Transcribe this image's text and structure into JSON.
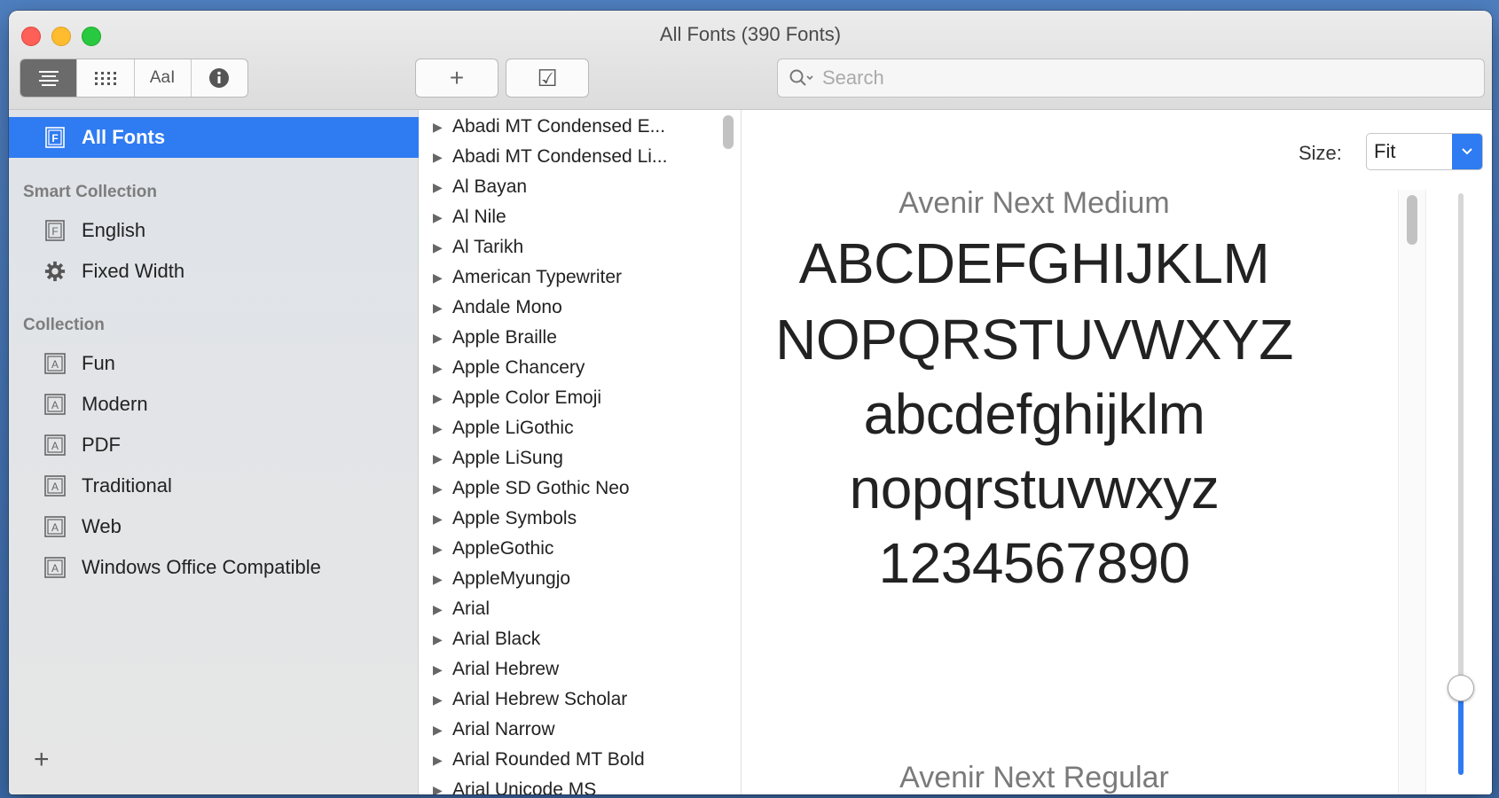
{
  "window": {
    "title": "All Fonts (390 Fonts)"
  },
  "toolbar": {
    "view_text_label": "AaI",
    "add_symbol": "+",
    "validate_symbol": "☑",
    "search_placeholder": "Search"
  },
  "sidebar": {
    "all_fonts": "All Fonts",
    "smart_heading": "Smart Collection",
    "smart_items": [
      "English",
      "Fixed Width"
    ],
    "collection_heading": "Collection",
    "collection_items": [
      "Fun",
      "Modern",
      "PDF",
      "Traditional",
      "Web",
      "Windows Office Compatible"
    ],
    "add_symbol": "+"
  },
  "font_list": [
    "Abadi MT Condensed E...",
    "Abadi MT Condensed Li...",
    "Al Bayan",
    "Al Nile",
    "Al Tarikh",
    "American Typewriter",
    "Andale Mono",
    "Apple Braille",
    "Apple Chancery",
    "Apple Color Emoji",
    "Apple LiGothic",
    "Apple LiSung",
    "Apple SD Gothic Neo",
    "Apple Symbols",
    "AppleGothic",
    "AppleMyungjo",
    "Arial",
    "Arial Black",
    "Arial Hebrew",
    "Arial Hebrew Scholar",
    "Arial Narrow",
    "Arial Rounded MT Bold",
    "Arial Unicode MS"
  ],
  "preview": {
    "size_label": "Size:",
    "size_value": "Fit",
    "font_name_1": "Avenir Next Medium",
    "lines": [
      "ABCDEFGHIJKLM",
      "NOPQRSTUVWXYZ",
      "abcdefghijklm",
      "nopqrstuvwxyz",
      "1234567890"
    ],
    "font_name_2": "Avenir Next Regular",
    "slider_level": 0.15
  },
  "colors": {
    "accent": "#2f7bf1",
    "close": "#fe5f57",
    "minimize": "#febc2e",
    "zoom": "#28c840"
  }
}
